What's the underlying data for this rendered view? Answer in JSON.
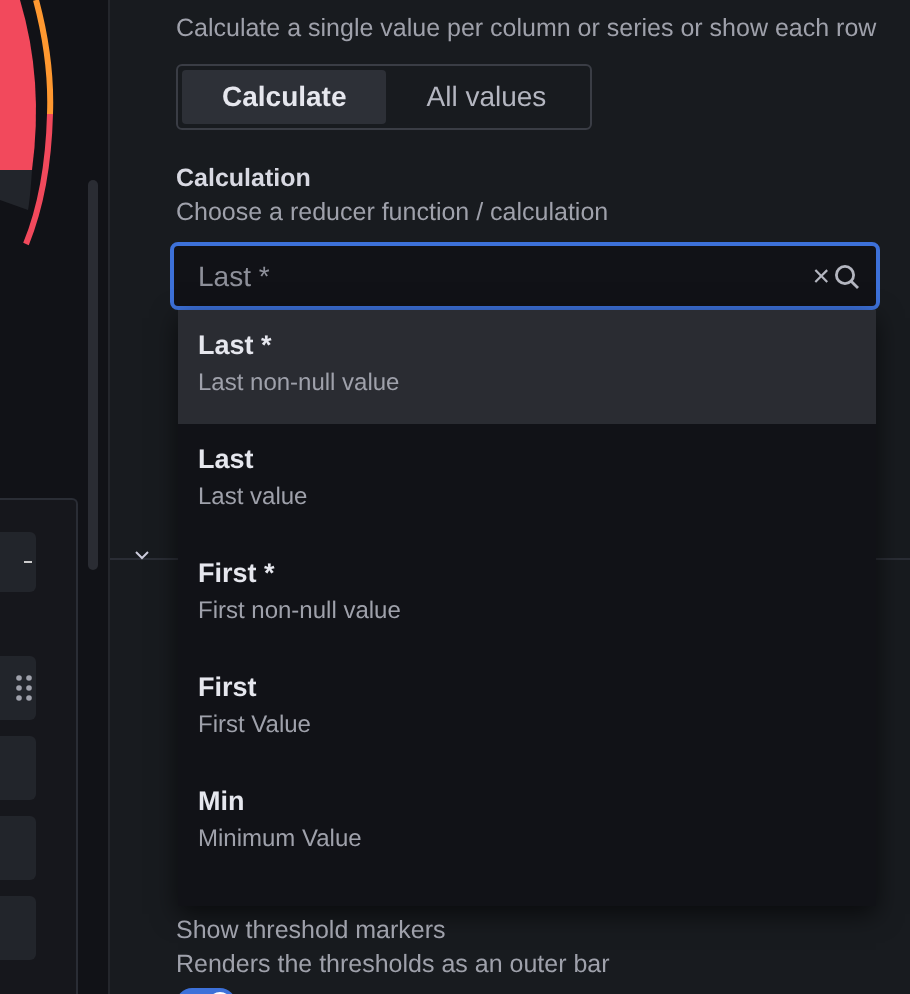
{
  "show_field": {
    "description": "Calculate a single value per column or series or show each row",
    "options": [
      {
        "label": "Calculate",
        "selected": true
      },
      {
        "label": "All values",
        "selected": false
      }
    ]
  },
  "calculation_field": {
    "label": "Calculation",
    "description": "Choose a reducer function / calculation",
    "placeholder": "Last *",
    "clear_icon": "×"
  },
  "dropdown": {
    "options": [
      {
        "title": "Last *",
        "subtitle": "Last non-null value",
        "selected": true
      },
      {
        "title": "Last",
        "subtitle": "Last value",
        "selected": false
      },
      {
        "title": "First *",
        "subtitle": "First non-null value",
        "selected": false
      },
      {
        "title": "First",
        "subtitle": "First Value",
        "selected": false
      },
      {
        "title": "Min",
        "subtitle": "Minimum Value",
        "selected": false
      }
    ]
  },
  "threshold_markers": {
    "label": "Show threshold markers",
    "description": "Renders the thresholds as an outer bar",
    "on": true
  }
}
